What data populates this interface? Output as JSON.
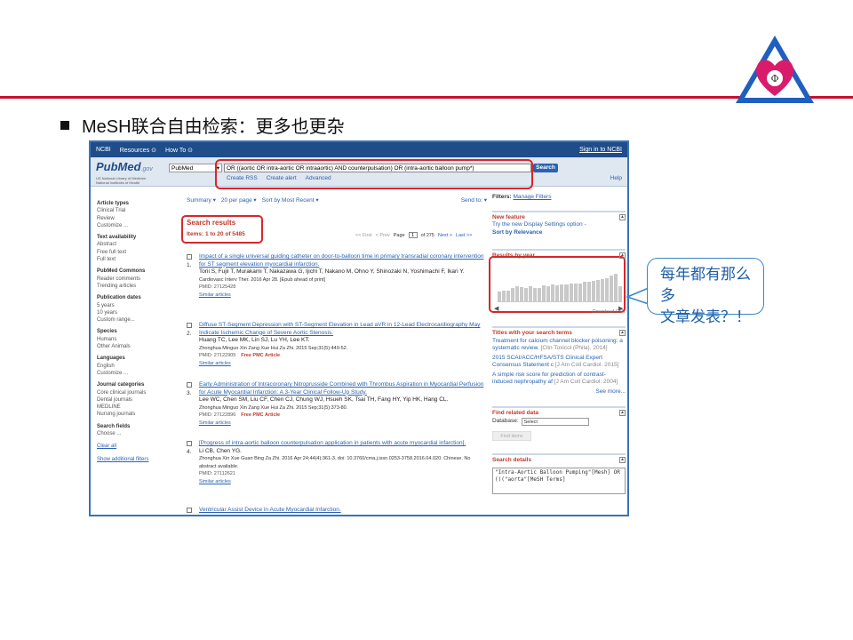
{
  "slide": {
    "title": "MeSH联合自由检索：更多也更杂",
    "callout": [
      "每年都有那么多",
      "文章发表？！"
    ]
  },
  "ncbi_bar": {
    "brand": "NCBI",
    "resources": "Resources ⊙",
    "howto": "How To ⊙",
    "signin": "Sign in to NCBI"
  },
  "pubmed_header": {
    "logo_main": "PubMed",
    "logo_suffix": ".gov",
    "subtitle1": "US National Library of Medicine",
    "subtitle2": "National Institutes of Health",
    "db_selected": "PubMed",
    "query": "OR ((aortic OR intra-aortic OR intraaortic) AND counterpulsation) OR (intra-aortic balloon pump*)",
    "search_label": "Search",
    "links": [
      "Create RSS",
      "Create alert",
      "Advanced"
    ],
    "help": "Help"
  },
  "sidebar": [
    {
      "head": "Article types",
      "items": [
        "Clinical Trial",
        "Review",
        "Customize ..."
      ]
    },
    {
      "head": "Text availability",
      "items": [
        "Abstract",
        "Free full text",
        "Full text"
      ]
    },
    {
      "head": "PubMed Commons",
      "items": [
        "Reader comments",
        "Trending articles"
      ]
    },
    {
      "head": "Publication dates",
      "items": [
        "5 years",
        "10 years",
        "Custom range..."
      ]
    },
    {
      "head": "Species",
      "items": [
        "Humans",
        "Other Animals"
      ]
    },
    {
      "head": "Languages",
      "items": [
        "English",
        "Customize ..."
      ]
    },
    {
      "head": "Journal categories",
      "items": [
        "Core clinical journals",
        "Dental journals",
        "MEDLINE",
        "Nursing journals"
      ]
    },
    {
      "head": "Search fields",
      "items": [
        "Choose ..."
      ]
    }
  ],
  "sidebar_links": {
    "clear": "Clear all",
    "show": "Show additional filters"
  },
  "toolbar": {
    "summary": "Summary ▾",
    "perpage": "20 per page ▾",
    "sort": "Sort by Most Recent ▾",
    "sendto": "Send to: ▾"
  },
  "results_header": {
    "title": "Search results",
    "items": "Items: 1 to 20 of 5485"
  },
  "pager": {
    "first": "<< First",
    "prev": "< Prev",
    "page_label": "Page",
    "page": "1",
    "of": "of 275",
    "next": "Next >",
    "last": "Last >>"
  },
  "results": [
    {
      "num": "1.",
      "title": "Impact of a single universal guiding catheter on door-to-balloon time in primary transradial coronary intervention for ST segment elevation myocardial infarction.",
      "authors": "Torii S, Fujii T, Murakami T, Nakazawa G, Ijichi T, Nakano M, Ohno Y, Shinozaki N, Yoshimachi F, Ikari Y.",
      "journal": "Cardiovasc Interv Ther. 2016 Apr 28. [Epub ahead of print]",
      "pmid": "PMID: 27125428",
      "pmc": "",
      "similar": "Similar articles"
    },
    {
      "num": "2.",
      "title": "Diffuse ST-Segment Depression with ST-Segment Elevation in Lead aVR in 12-Lead Electrocardiography May Indicate Ischemic Change of Severe Aortic Stenosis.",
      "authors": "Huang TC, Lee MK, Lin SJ, Lu YH, Lee KT.",
      "journal": "Zhonghua Minguo Xin Zang Xue Hui Za Zhi. 2015 Sep;31(5):449-52.",
      "pmid": "PMID: 27122905",
      "pmc": "Free PMC Article",
      "similar": "Similar articles"
    },
    {
      "num": "3.",
      "title": "Early Administration of Intracoronary Nitroprusside Combined with Thrombus Aspiration in Myocardial Perfusion for Acute Myocardial Infarction: A 3-Year Clinical Follow-Up Study.",
      "authors": "Lee WC, Chen SM, Liu CF, Chen CJ, Chung WJ, Hsueh SK, Tsai TH, Fang HY, Yip HK, Hang CL.",
      "journal": "Zhonghua Minguo Xin Zang Xue Hui Za Zhi. 2015 Sep;31(5):373-80.",
      "pmid": "PMID: 27122896",
      "pmc": "Free PMC Article",
      "similar": "Similar articles"
    },
    {
      "num": "4.",
      "title": "[Progress of intra-aortic balloon counterpulsation application in patients with acute myocardial infarction].",
      "authors": "Li CB, Chen YG.",
      "journal": "Zhonghua Xin Xue Guan Bing Za Zhi. 2016 Apr 24;44(4):361-3. doi: 10.3760/cma.j.issn.0253-3758.2016.04.020. Chinese. No abstract available.",
      "pmid": "PMID: 27112621",
      "pmc": "",
      "similar": "Similar articles"
    },
    {
      "num": "",
      "title": "Ventricular Assist Device in Acute Myocardial Infarction.",
      "authors": "",
      "journal": "",
      "pmid": "",
      "pmc": "",
      "similar": ""
    }
  ],
  "right": {
    "filters": "Filters:",
    "manage": "Manage Filters",
    "new_feature_head": "New feature",
    "new_feature_text": "Try the new Display Settings option -",
    "new_feature_sort": "Sort by Relevance",
    "rby_head": "Results by year",
    "download": "Download CSV",
    "titles_head": "Titles with your search terms",
    "titles": [
      {
        "t": "Treatment for calcium channel blocker poisoning: a systematic review.",
        "s": "[Clin Toxicol (Phila). 2014]"
      },
      {
        "t": "2015 SCAI/ACC/HFSA/STS Clinical Expert Consensus Statement c",
        "s": "[J Am Coll Cardiol. 2015]"
      },
      {
        "t": "A simple risk score for prediction of contrast-induced nephropathy af",
        "s": "[J Am Coll Cardiol. 2004]"
      }
    ],
    "see_more": "See more...",
    "related_head": "Find related data",
    "database_label": "Database:",
    "database_value": "Select",
    "find_items": "Find items",
    "details_head": "Search details",
    "details_text": "\"Intra-Aortic Balloon Pumping\"[Mesh] OR (((\"aorta\"[MeSH Terms]"
  },
  "year_bars": [
    0.35,
    0.4,
    0.38,
    0.5,
    0.55,
    0.52,
    0.5,
    0.55,
    0.48,
    0.5,
    0.57,
    0.55,
    0.6,
    0.58,
    0.62,
    0.6,
    0.65,
    0.63,
    0.66,
    0.7,
    0.72,
    0.75,
    0.78,
    0.82,
    0.85,
    0.92,
    1.0,
    0.55
  ],
  "colors": {
    "accent_red": "#d8262b",
    "link_blue": "#2a63b0",
    "ncbi_blue": "#1f4d8a"
  }
}
